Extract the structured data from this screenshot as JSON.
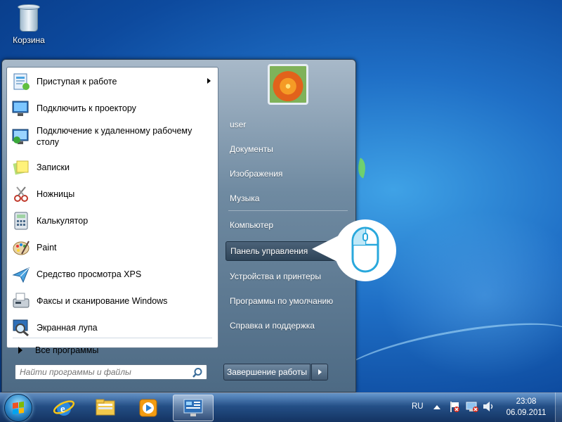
{
  "desktop": {
    "recycle_bin_label": "Корзина"
  },
  "start_menu": {
    "programs": [
      {
        "label": "Приступая к работе",
        "icon": "getting-started-icon",
        "has_submenu": true
      },
      {
        "label": "Подключить к проектору",
        "icon": "projector-icon"
      },
      {
        "label": "Подключение к удаленному рабочему столу",
        "icon": "remote-desktop-icon"
      },
      {
        "label": "Записки",
        "icon": "sticky-notes-icon"
      },
      {
        "label": "Ножницы",
        "icon": "scissors-icon"
      },
      {
        "label": "Калькулятор",
        "icon": "calculator-icon"
      },
      {
        "label": "Paint",
        "icon": "paint-palette-icon"
      },
      {
        "label": "Средство просмотра XPS",
        "icon": "xps-viewer-icon"
      },
      {
        "label": "Факсы и сканирование Windows",
        "icon": "fax-scan-icon"
      },
      {
        "label": "Экранная лупа",
        "icon": "magnifier-icon"
      }
    ],
    "all_programs": "Все программы",
    "search_placeholder": "Найти программы и файлы",
    "right_items": [
      {
        "label": "user"
      },
      {
        "label": "Документы"
      },
      {
        "label": "Изображения"
      },
      {
        "label": "Музыка"
      },
      {
        "label": "Компьютер"
      },
      {
        "label": "Панель управления",
        "highlighted": true
      },
      {
        "label": "Устройства и принтеры"
      },
      {
        "label": "Программы по умолчанию"
      },
      {
        "label": "Справка и поддержка"
      }
    ],
    "shutdown_label": "Завершение работы"
  },
  "taskbar": {
    "pinned": [
      "internet-explorer-icon",
      "explorer-folder-icon",
      "media-player-icon",
      "control-panel-icon"
    ],
    "language": "RU",
    "time": "23:08",
    "date": "06.09.2011"
  },
  "colors": {
    "accent_blue": "#1f6fc6",
    "menu_right": "#6f8aa1",
    "highlight": "#2e4458"
  }
}
